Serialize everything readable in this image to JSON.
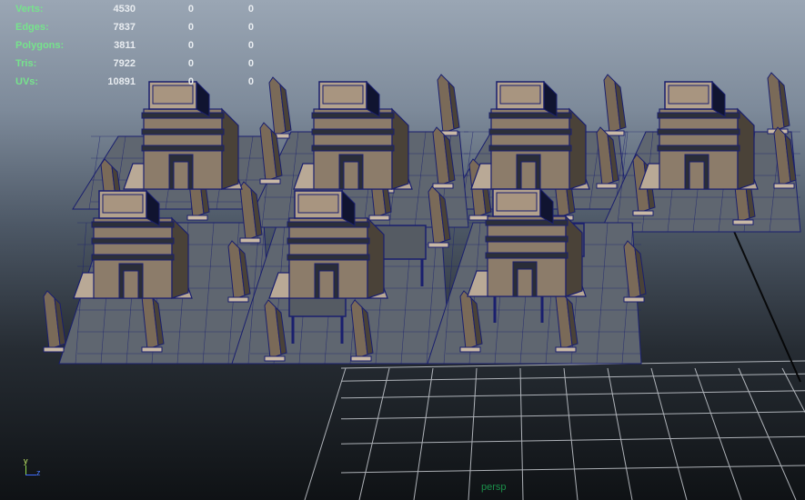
{
  "hud": {
    "rows": [
      {
        "label": "Verts:",
        "v1": "4530",
        "v2": "0",
        "v3": "0"
      },
      {
        "label": "Edges:",
        "v1": "7837",
        "v2": "0",
        "v3": "0"
      },
      {
        "label": "Polygons:",
        "v1": "3811",
        "v2": "0",
        "v3": "0"
      },
      {
        "label": "Tris:",
        "v1": "7922",
        "v2": "0",
        "v3": "0"
      },
      {
        "label": "UVs:",
        "v1": "10891",
        "v2": "0",
        "v3": "0"
      }
    ]
  },
  "viewport": {
    "camera_label": "persp",
    "axis": {
      "y_label": "y",
      "z_label": "z"
    }
  },
  "colors": {
    "hud_label": "#76e38c",
    "hud_value": "#e8ecf0",
    "wireframe": "#1a1f6e",
    "grid": "#c8ccd2",
    "stone_light": "#9a8a78",
    "stone_dark": "#4a4238",
    "camera_label": "#1b8f4a"
  },
  "icons": [
    "axis-gizmo-icon"
  ]
}
